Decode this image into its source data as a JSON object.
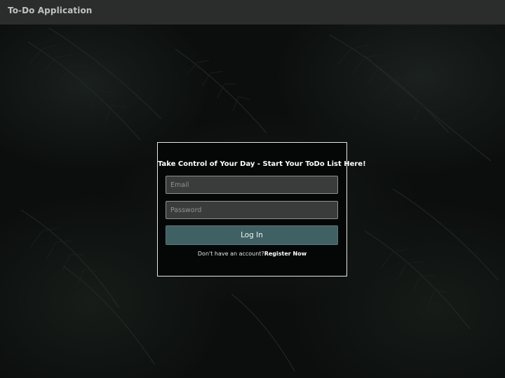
{
  "header": {
    "title": "To-Do Application"
  },
  "login": {
    "heading": "Take Control of Your Day - Start Your ToDo List Here!",
    "email_placeholder": "Email",
    "password_placeholder": "Password",
    "login_label": "Log In",
    "register_prompt": "Don't have an account?",
    "register_link": "Register Now"
  },
  "colors": {
    "header_bg": "#2b2d2d",
    "card_border": "#e6e6e6",
    "button_bg": "#3f6163",
    "field_bg": "#3a3c3c"
  }
}
